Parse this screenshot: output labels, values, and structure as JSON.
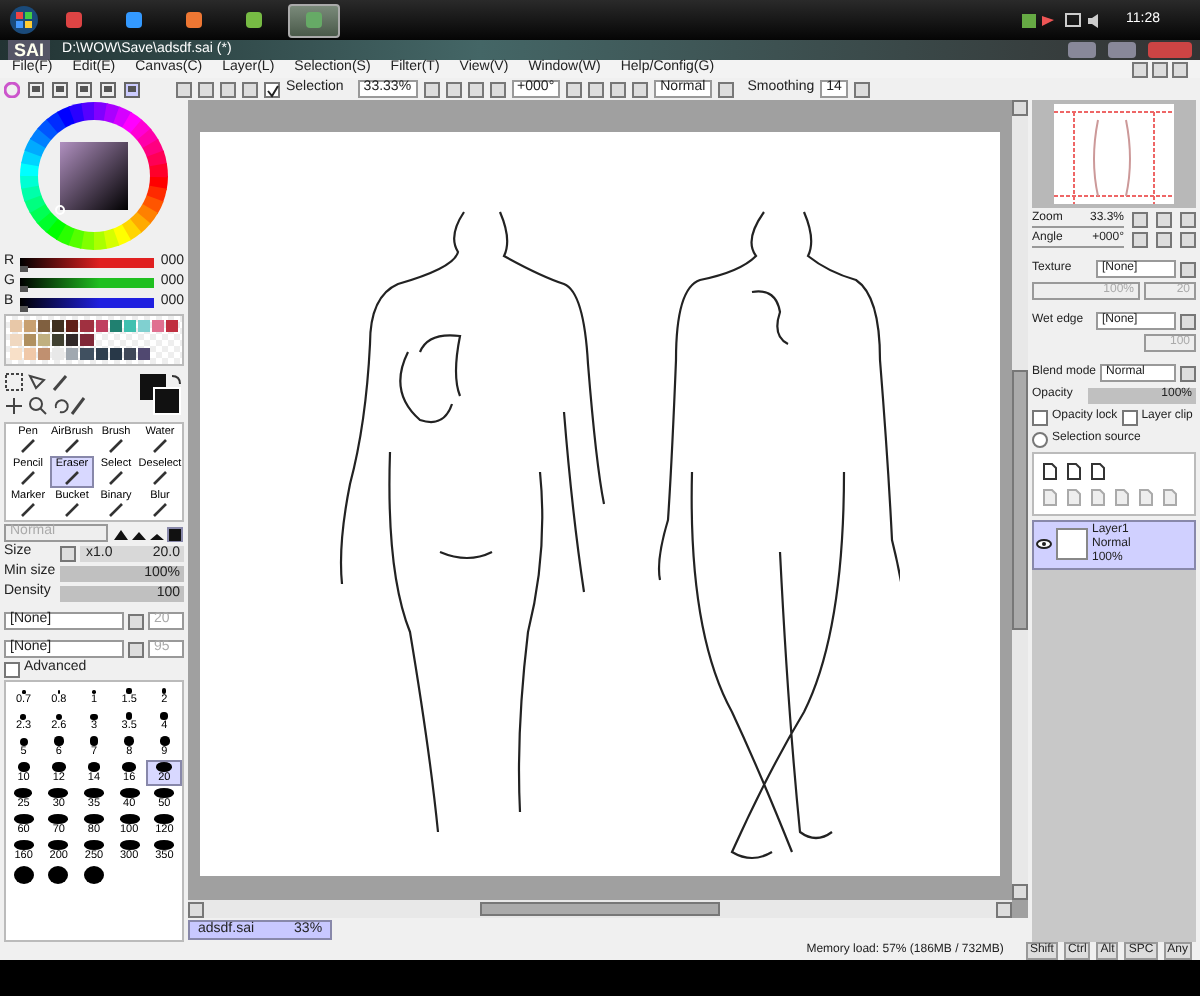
{
  "taskbar": {
    "apps": [
      {
        "selected": false
      },
      {
        "selected": false
      },
      {
        "selected": false
      },
      {
        "selected": false
      },
      {
        "selected": true
      }
    ],
    "clock": "11:28"
  },
  "window": {
    "logo": "SAI",
    "title": "D:\\WOW\\Save\\adsdf.sai (*)"
  },
  "menu": [
    "File(F)",
    "Edit(E)",
    "Canvas(C)",
    "Layer(L)",
    "Selection(S)",
    "Filter(T)",
    "View(V)",
    "Window(W)",
    "Help/Config(G)"
  ],
  "toolbar": {
    "selection": {
      "label": "Selection",
      "checked": true
    },
    "zoom": "33.33%",
    "angle": "+000°",
    "blend": "Normal",
    "smoothing_label": "Smoothing",
    "smoothing": "14"
  },
  "color": {
    "channels": [
      {
        "label": "R",
        "value": "000",
        "color": "#e02020",
        "level": 0
      },
      {
        "label": "G",
        "value": "000",
        "color": "#20c020",
        "level": 0
      },
      {
        "label": "B",
        "value": "000",
        "color": "#2020e0",
        "level": 0
      }
    ]
  },
  "swatches": [
    {
      "color": "#e8c8a8"
    },
    {
      "color": "#c8a070"
    },
    {
      "color": "#806040"
    },
    {
      "color": "#403020"
    },
    {
      "color": "#602018"
    },
    {
      "color": "#a03040"
    },
    {
      "color": "#c04060"
    },
    {
      "color": "#208070"
    },
    {
      "color": "#40c0b0"
    },
    {
      "color": "#80d0d0"
    },
    {
      "color": "#e07090"
    },
    {
      "color": "#c03040"
    },
    {
      "color": "#f0d8c0"
    },
    {
      "color": "#b09060"
    },
    {
      "color": "#c0b080"
    },
    {
      "color": "#404030"
    },
    {
      "color": "#302828"
    },
    {
      "color": "#802838"
    },
    {
      "color": "#f8e0c8"
    },
    {
      "color": "#f0c8a8"
    },
    {
      "color": "#c09070"
    },
    {
      "color": "#e8e8e8"
    },
    {
      "color": "#a0a8b0"
    },
    {
      "color": "#405060"
    },
    {
      "color": "#304050"
    },
    {
      "color": "#283848"
    },
    {
      "color": "#404858"
    },
    {
      "color": "#504870"
    }
  ],
  "tools": [
    {
      "label": "Pen",
      "selected": false
    },
    {
      "label": "AirBrush",
      "selected": false
    },
    {
      "label": "Brush",
      "selected": false
    },
    {
      "label": "Water",
      "selected": false
    },
    {
      "label": "Pencil",
      "selected": false
    },
    {
      "label": "Eraser",
      "selected": true
    },
    {
      "label": "Select",
      "selected": false
    },
    {
      "label": "Deselect",
      "selected": false
    },
    {
      "label": "Marker",
      "selected": false
    },
    {
      "label": "Bucket",
      "selected": false
    },
    {
      "label": "Binary",
      "selected": false
    },
    {
      "label": "Blur",
      "selected": false
    }
  ],
  "brush": {
    "mode": "Normal",
    "size_label": "Size",
    "size_multiplier": "x1.0",
    "size": "20.0",
    "min_size": {
      "label": "Min size",
      "value": "100%",
      "level": 1
    },
    "density": {
      "label": "Density",
      "value": "100",
      "level": 1
    },
    "dropdowns": [
      {
        "value": "[None]",
        "extra": "20"
      },
      {
        "value": "[None]",
        "extra": "95"
      }
    ],
    "advanced": {
      "label": "Advanced",
      "checked": false
    }
  },
  "brush_sizes": [
    {
      "label": "0.7",
      "selected": false
    },
    {
      "label": "0.8",
      "selected": false
    },
    {
      "label": "1",
      "selected": false
    },
    {
      "label": "1.5",
      "selected": false
    },
    {
      "label": "2",
      "selected": false
    },
    {
      "label": "2.3",
      "selected": false
    },
    {
      "label": "2.6",
      "selected": false
    },
    {
      "label": "3",
      "selected": false
    },
    {
      "label": "3.5",
      "selected": false
    },
    {
      "label": "4",
      "selected": false
    },
    {
      "label": "5",
      "selected": false
    },
    {
      "label": "6",
      "selected": false
    },
    {
      "label": "7",
      "selected": false
    },
    {
      "label": "8",
      "selected": false
    },
    {
      "label": "9",
      "selected": false
    },
    {
      "label": "10",
      "selected": false
    },
    {
      "label": "12",
      "selected": false
    },
    {
      "label": "14",
      "selected": false
    },
    {
      "label": "16",
      "selected": false
    },
    {
      "label": "20",
      "selected": true
    },
    {
      "label": "25",
      "selected": false
    },
    {
      "label": "30",
      "selected": false
    },
    {
      "label": "35",
      "selected": false
    },
    {
      "label": "40",
      "selected": false
    },
    {
      "label": "50",
      "selected": false
    },
    {
      "label": "60",
      "selected": false
    },
    {
      "label": "70",
      "selected": false
    },
    {
      "label": "80",
      "selected": false
    },
    {
      "label": "100",
      "selected": false
    },
    {
      "label": "120",
      "selected": false
    },
    {
      "label": "160",
      "selected": false
    },
    {
      "label": "200",
      "selected": false
    },
    {
      "label": "250",
      "selected": false
    },
    {
      "label": "300",
      "selected": false
    },
    {
      "label": "350",
      "selected": false
    }
  ],
  "document_tabs": [
    {
      "name": "adsdf.sai",
      "zoom": "33%",
      "selected": true
    }
  ],
  "navigator": {
    "zoom_label": "Zoom",
    "zoom": "33.3%",
    "angle_label": "Angle",
    "angle": "+000°"
  },
  "texture": {
    "label": "Texture",
    "value": "[None]",
    "scale": "100%",
    "contrast": "20"
  },
  "wet_edge": {
    "label": "Wet edge",
    "value": "[None]",
    "amount": "100"
  },
  "layer_settings": {
    "blend_label": "Blend mode",
    "blend": "Normal",
    "opacity": {
      "label": "Opacity",
      "value": "100%",
      "level": 1
    },
    "options": [
      {
        "label": "Opacity lock",
        "checked": false
      },
      {
        "label": "Layer clip",
        "checked": false
      }
    ],
    "selection_source": {
      "label": "Selection source",
      "selected": false
    }
  },
  "layers": [
    {
      "name": "Layer1",
      "mode": "Normal",
      "opacity": "100%",
      "selected": true,
      "visible": true
    }
  ],
  "status": {
    "memory": "Memory load: 57% (186MB / 732MB)",
    "keys": [
      "Shift",
      "Ctrl",
      "Alt",
      "SPC",
      "Any"
    ]
  }
}
